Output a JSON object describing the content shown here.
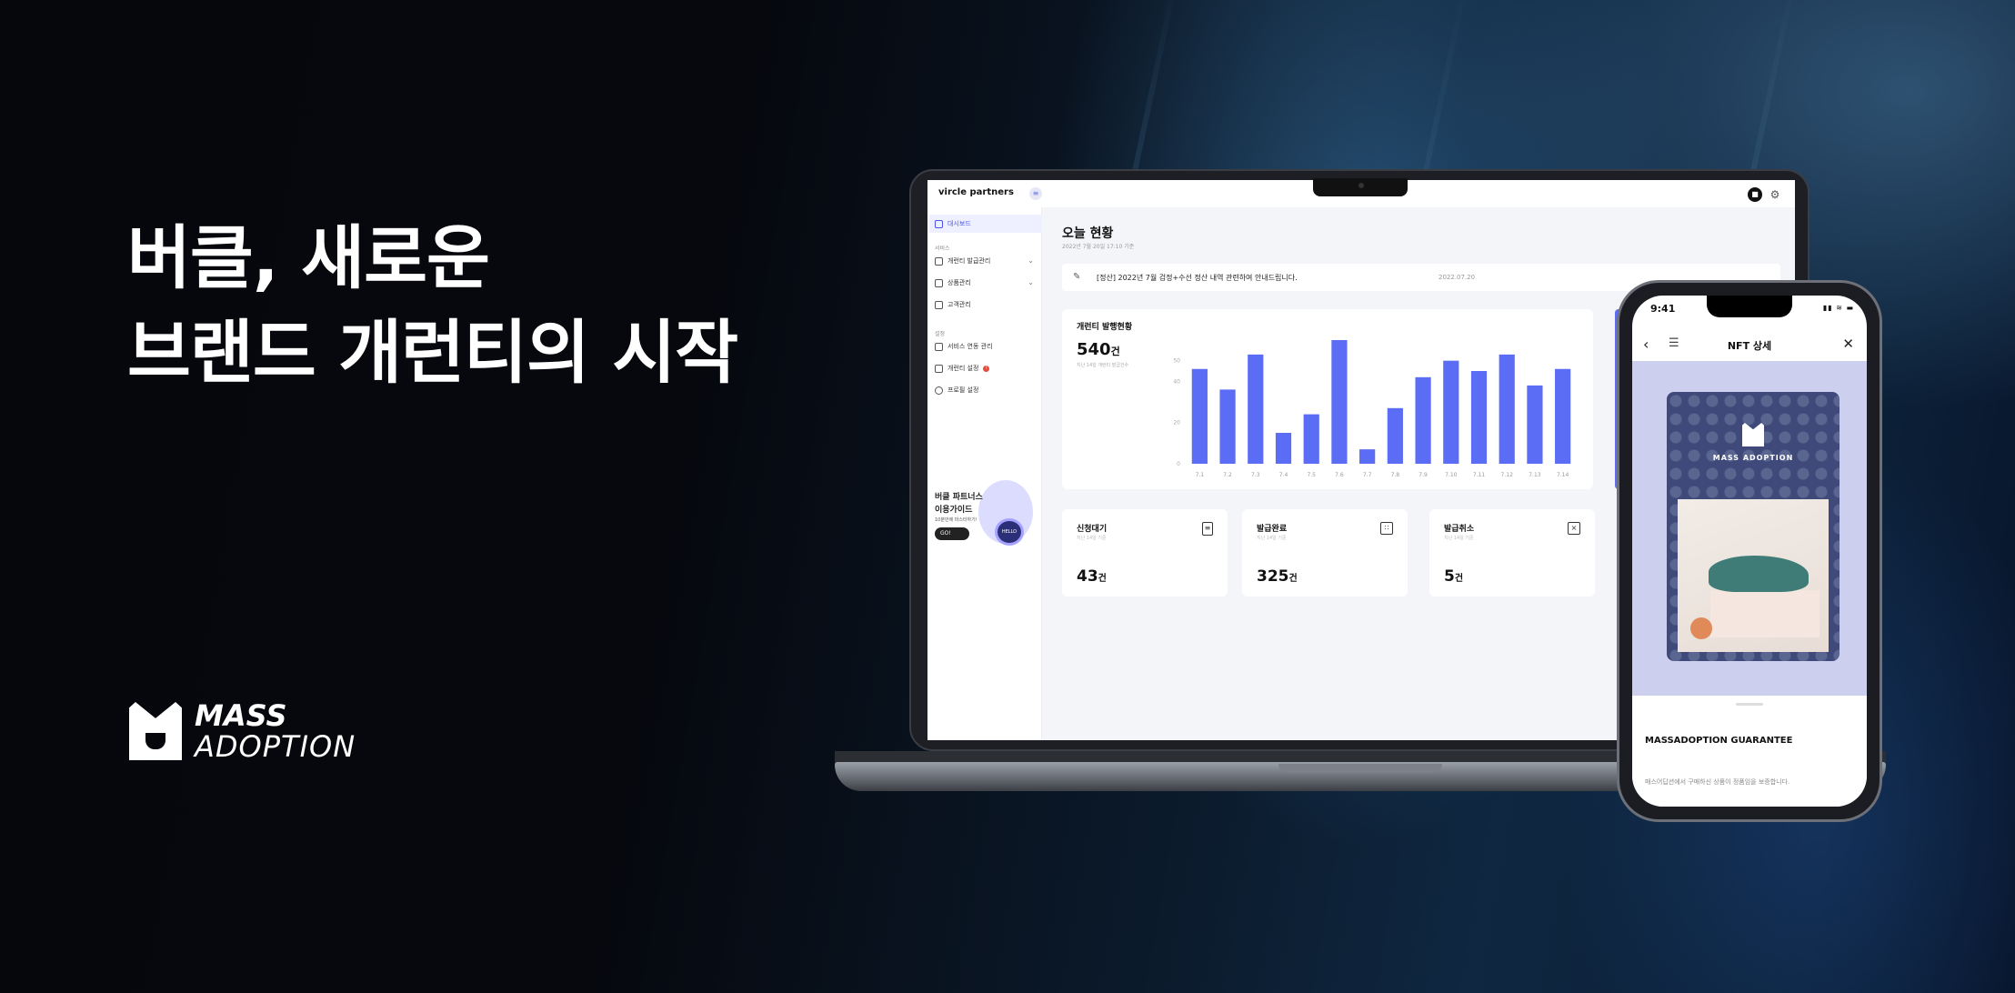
{
  "headline": {
    "line1": "버클, 새로운",
    "line2": "브랜드 개런티의 시작"
  },
  "logo": {
    "line1": "MASS",
    "line2": "ADOPTION"
  },
  "dashboard": {
    "brand": "vircle partners",
    "sidebar": {
      "items_top": [
        {
          "label": "대시보드"
        }
      ],
      "section_service": "서비스",
      "service_items": [
        {
          "label": "개런티 발급관리"
        },
        {
          "label": "상품관리"
        },
        {
          "label": "고객관리"
        }
      ],
      "section_settings": "설정",
      "settings_items": [
        {
          "label": "서비스 연동 관리"
        },
        {
          "label": "개런티 설정"
        },
        {
          "label": "프로필 설정"
        }
      ],
      "guide_title1": "버클 파트너스",
      "guide_title2": "이용가이드",
      "guide_sub": "10분만에 마스터하기!",
      "guide_button": "GO!",
      "robot_text": "HELLO"
    },
    "page_title": "오늘 현황",
    "page_subtitle": "2022년 7월 20일 17:10 기준",
    "notice": {
      "text": "[정산] 2022년 7월 검정+수선 정산 내역 관련하여 안내드립니다.",
      "date": "2022.07.20"
    },
    "chart_card": {
      "title": "개런티 발행현황",
      "total_value": "540",
      "total_unit": "건",
      "total_sub": "지난 14일 개런티 발급건수"
    },
    "stats": [
      {
        "title": "신청대기",
        "sub": "지난 14일 기준",
        "value": "43",
        "unit": "건"
      },
      {
        "title": "발급완료",
        "sub": "지난 14일 기준",
        "value": "325",
        "unit": "건"
      },
      {
        "title": "발급취소",
        "sub": "지난 14일 기준",
        "value": "5",
        "unit": "건"
      }
    ]
  },
  "chart_data": {
    "type": "bar",
    "categories": [
      "7.1",
      "7.2",
      "7.3",
      "7.4",
      "7.5",
      "7.6",
      "7.7",
      "7.8",
      "7.9",
      "7.10",
      "7.11",
      "7.12",
      "7.13",
      "7.14"
    ],
    "values": [
      46,
      36,
      53,
      15,
      24,
      60,
      7,
      27,
      42,
      50,
      45,
      53,
      38,
      46
    ],
    "ylim": [
      0,
      60
    ],
    "yticks": [
      0,
      20,
      40,
      50
    ],
    "title": "개런티 발행현황",
    "xlabel": "",
    "ylabel": "",
    "color": "#5b6cf5"
  },
  "phone": {
    "time": "9:41",
    "title": "NFT 상세",
    "nft_name": "MASS ADOPTION",
    "guarantee_title": "MASSADOPTION GUARANTEE",
    "guarantee_text": "매스어답션에서 구매하신 상품이 정품임을 보증합니다."
  },
  "colors": {
    "accent": "#5b6cf5",
    "background": "#05070c"
  }
}
